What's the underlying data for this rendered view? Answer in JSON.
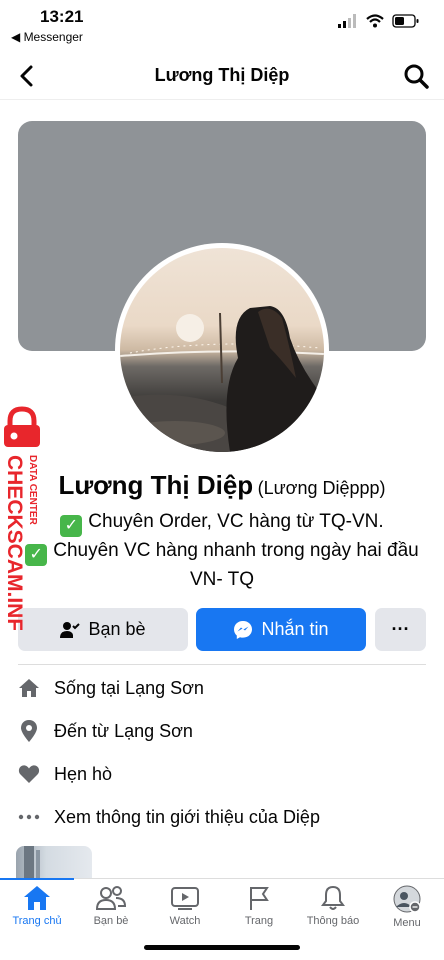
{
  "status_bar": {
    "time": "13:21",
    "back_app": "◀ Messenger"
  },
  "nav": {
    "title": "Lương Thị Diệp"
  },
  "profile": {
    "name": "Lương Thị Diệp",
    "alt_name": "(Lương Diệppp)",
    "bio": [
      "Chuyên Order, VC hàng từ TQ-VN.",
      "Chuyên VC hàng nhanh trong ngày hai đầu VN- TQ"
    ]
  },
  "actions": {
    "friends_label": "Bạn bè",
    "message_label": "Nhắn tin",
    "more_label": "···"
  },
  "info": [
    {
      "icon": "home-icon",
      "prefix": "Sống tại ",
      "value": "Lạng Sơn"
    },
    {
      "icon": "location-pin-icon",
      "prefix": "Đến từ ",
      "value": "Lạng Sơn"
    },
    {
      "icon": "heart-icon",
      "prefix": "Hẹn hò",
      "value": ""
    },
    {
      "icon": "more-dots-icon",
      "prefix": "Xem thông tin giới thiệu của Diệp",
      "value": ""
    }
  ],
  "watermark": {
    "brand": "CHECKSCAM.INFO",
    "sub": "DATA CENTER"
  },
  "tabs": [
    {
      "label": "Trang chủ",
      "icon": "home-icon",
      "active": true
    },
    {
      "label": "Bạn bè",
      "icon": "friends-icon",
      "active": false
    },
    {
      "label": "Watch",
      "icon": "watch-icon",
      "active": false
    },
    {
      "label": "Trang",
      "icon": "flag-icon",
      "active": false
    },
    {
      "label": "Thông báo",
      "icon": "bell-icon",
      "active": false
    },
    {
      "label": "Menu",
      "icon": "menu-avatar-icon",
      "active": false
    }
  ],
  "colors": {
    "accent": "#1877f2",
    "watermark_red": "#e8262c",
    "check_green": "#47b64a"
  }
}
